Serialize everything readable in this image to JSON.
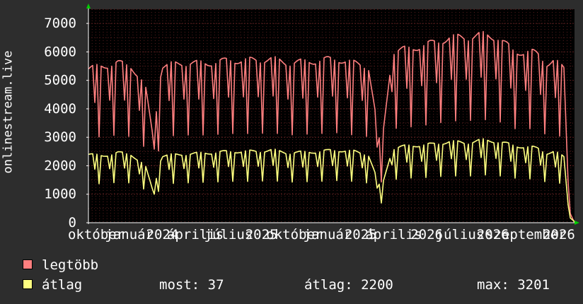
{
  "chart_data": {
    "type": "line",
    "ylabel": "onlinestream.live",
    "ylim": [
      0,
      7500
    ],
    "y_ticks": [
      0,
      1000,
      2000,
      3000,
      4000,
      5000,
      6000,
      7000
    ],
    "x_range": [
      "2023-09-20",
      "2026-03-25"
    ],
    "x_tick_labels": [
      "október",
      "január",
      "2024",
      "április",
      "július",
      "2025",
      "október",
      "január",
      "2025",
      "április",
      "2026",
      "július",
      "2026",
      "szeptember",
      "2026"
    ],
    "grid": true,
    "background": "#000000",
    "series": [
      {
        "name": "legtöbb",
        "color": "#ff7f7f",
        "x": [
          "2023-09-20",
          "2023-10-15",
          "2023-11-15",
          "2023-12-10",
          "2024-01-05",
          "2024-01-20",
          "2024-02-05",
          "2024-03-15",
          "2024-05-01",
          "2024-06-15",
          "2024-08-01",
          "2024-09-01",
          "2024-10-01",
          "2024-12-01",
          "2025-01-01",
          "2025-02-01",
          "2025-03-01",
          "2025-03-25",
          "2025-04-15",
          "2025-05-15",
          "2025-07-01",
          "2025-08-01",
          "2025-09-01",
          "2025-10-01",
          "2025-11-01",
          "2025-12-01",
          "2026-01-01",
          "2026-01-15",
          "2026-02-01",
          "2026-02-15",
          "2026-03-05",
          "2026-03-15",
          "2026-03-25"
        ],
        "values": [
          5400,
          5500,
          5600,
          5500,
          4800,
          3000,
          5500,
          5600,
          5600,
          5700,
          5700,
          5750,
          5600,
          5700,
          5750,
          5600,
          5500,
          2500,
          6000,
          6100,
          6300,
          6500,
          6500,
          6600,
          6500,
          6000,
          6000,
          5900,
          5600,
          5700,
          5400,
          400,
          0
        ]
      },
      {
        "name": "átlag",
        "color": "#ffff80",
        "x": [
          "2023-09-20",
          "2023-10-15",
          "2023-11-15",
          "2023-12-10",
          "2024-01-05",
          "2024-01-20",
          "2024-02-05",
          "2024-03-15",
          "2024-05-01",
          "2024-06-15",
          "2024-08-01",
          "2024-09-01",
          "2024-10-01",
          "2024-12-01",
          "2025-01-01",
          "2025-02-01",
          "2025-03-01",
          "2025-03-25",
          "2025-04-15",
          "2025-05-15",
          "2025-07-01",
          "2025-08-01",
          "2025-09-01",
          "2025-10-01",
          "2025-11-01",
          "2025-12-01",
          "2026-01-01",
          "2026-01-15",
          "2026-02-01",
          "2026-02-15",
          "2026-03-05",
          "2026-03-15",
          "2026-03-25"
        ],
        "values": [
          2400,
          2350,
          2450,
          2400,
          2000,
          1100,
          2350,
          2400,
          2450,
          2500,
          2500,
          2550,
          2450,
          2500,
          2550,
          2500,
          2400,
          1150,
          2600,
          2700,
          2750,
          2850,
          2800,
          2900,
          2850,
          2700,
          2650,
          2600,
          2450,
          2500,
          2300,
          200,
          37
        ]
      }
    ]
  },
  "legend": {
    "items": [
      {
        "label": "legtöbb",
        "color": "#ff7f7f"
      },
      {
        "label": "átlag",
        "color": "#ffff80"
      }
    ],
    "stats": {
      "now_label": "most:",
      "now_value": "37",
      "avg_label": "átlag:",
      "avg_value": "2200",
      "max_label": "max:",
      "max_value": "3201"
    }
  },
  "colors": {
    "page_bg": "#2d2d2d",
    "plot_bg": "#000000",
    "grid": "#5a1f1f",
    "axis": "#ffffff",
    "arrow": "#00cc00"
  }
}
